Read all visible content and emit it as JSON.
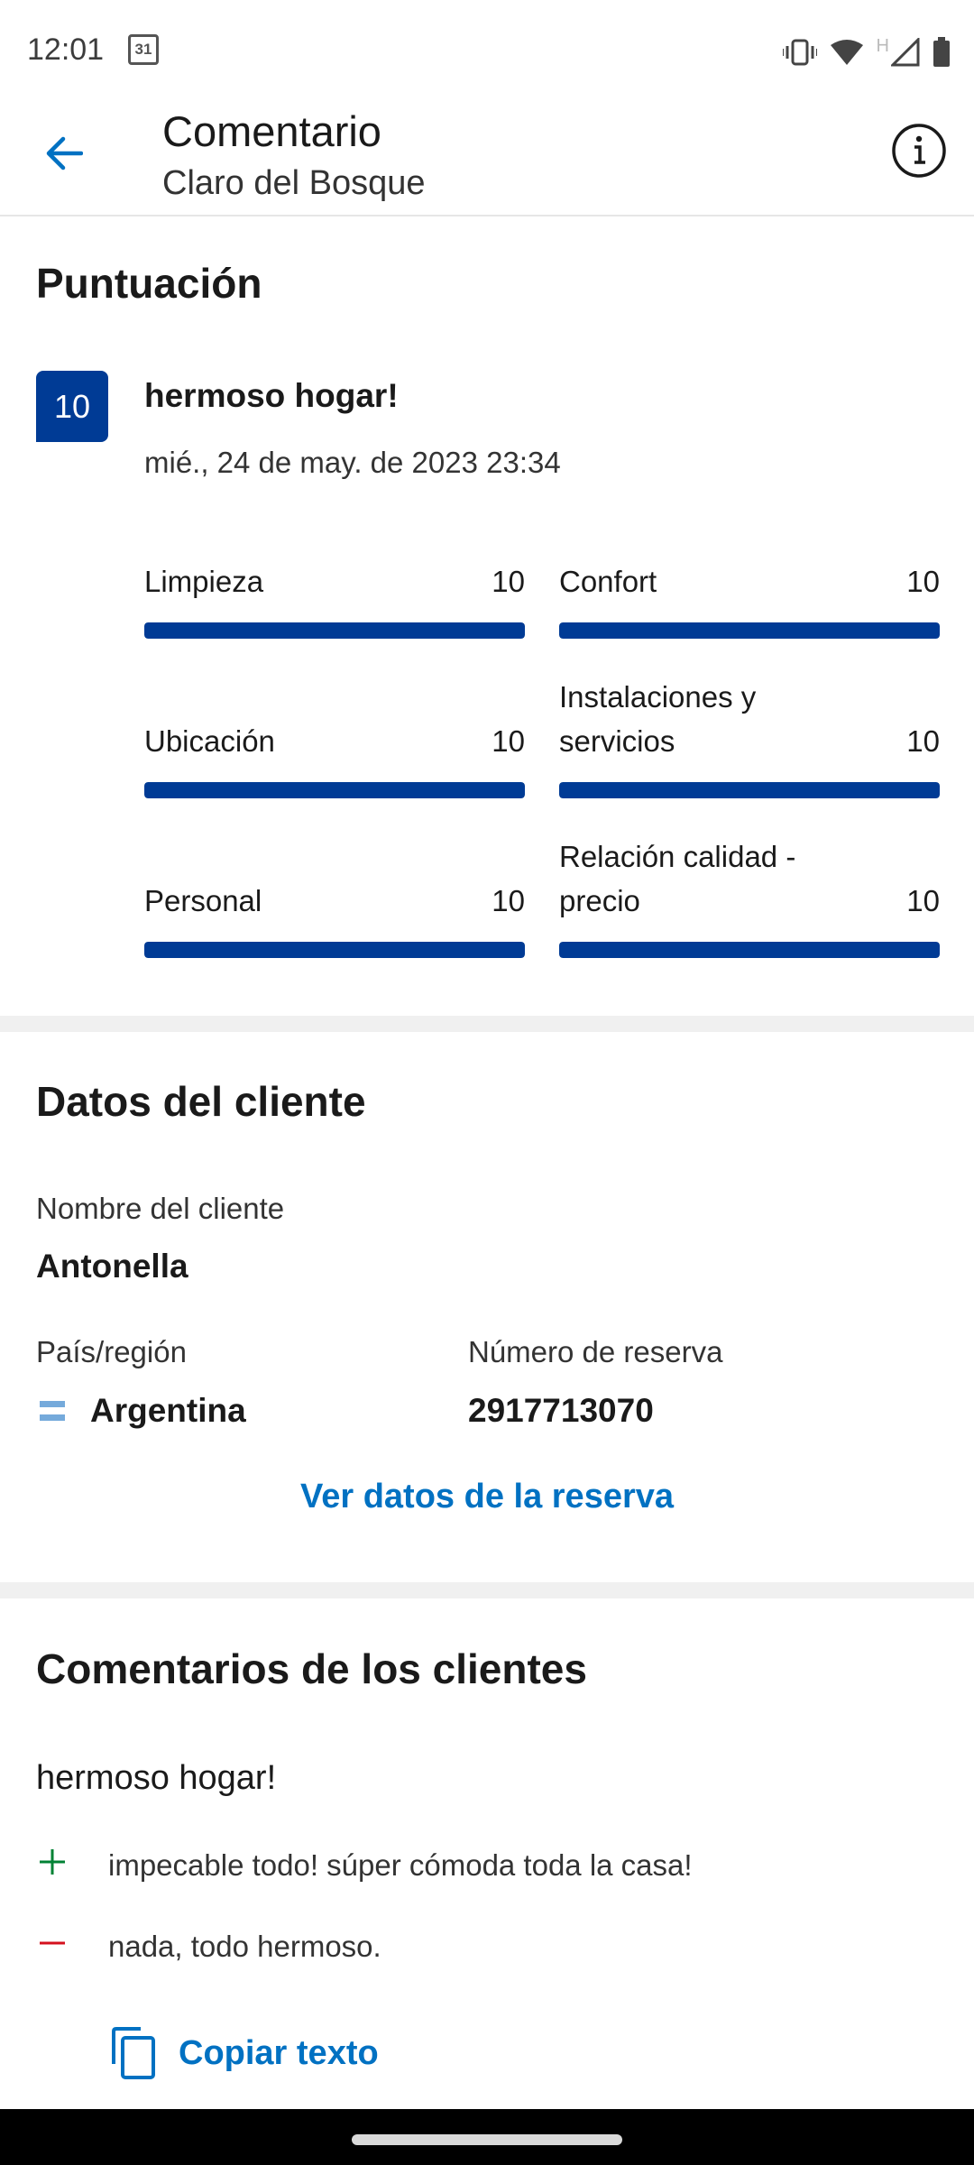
{
  "status_bar": {
    "time": "12:01",
    "calendar_day": "31",
    "network_label": "H"
  },
  "app_bar": {
    "title": "Comentario",
    "subtitle": "Claro del Bosque"
  },
  "score_section": {
    "title": "Puntuación",
    "score": "10",
    "review_title": "hermoso hogar!",
    "date": "mié., 24 de may. de 2023 23:34",
    "categories": [
      {
        "label": "Limpieza",
        "value": "10",
        "fill_fraction": 1.0
      },
      {
        "label": "Confort",
        "value": "10",
        "fill_fraction": 1.0
      },
      {
        "label": "Ubicación",
        "value": "10",
        "fill_fraction": 1.0
      },
      {
        "label": "Instalaciones y servicios",
        "value": "10",
        "fill_fraction": 1.0
      },
      {
        "label": "Personal",
        "value": "10",
        "fill_fraction": 1.0
      },
      {
        "label": "Relación calidad - precio",
        "value": "10",
        "fill_fraction": 1.0
      }
    ]
  },
  "guest_section": {
    "title": "Datos del cliente",
    "name_label": "Nombre del cliente",
    "name": "Antonella",
    "country_label": "País/región",
    "country": "Argentina",
    "booking_label": "Número de reserva",
    "booking_number": "2917713070",
    "link": "Ver datos de la reserva"
  },
  "comments_section": {
    "title": "Comentarios de los clientes",
    "comment_title": "hermoso hogar!",
    "positive": "impecable todo! súper cómoda toda la casa!",
    "negative": "nada, todo hermoso.",
    "copy_label": "Copiar texto"
  },
  "colors": {
    "brand_dark": "#003b95",
    "link_blue": "#0071c2",
    "positive": "#008234",
    "negative": "#d4111e"
  }
}
